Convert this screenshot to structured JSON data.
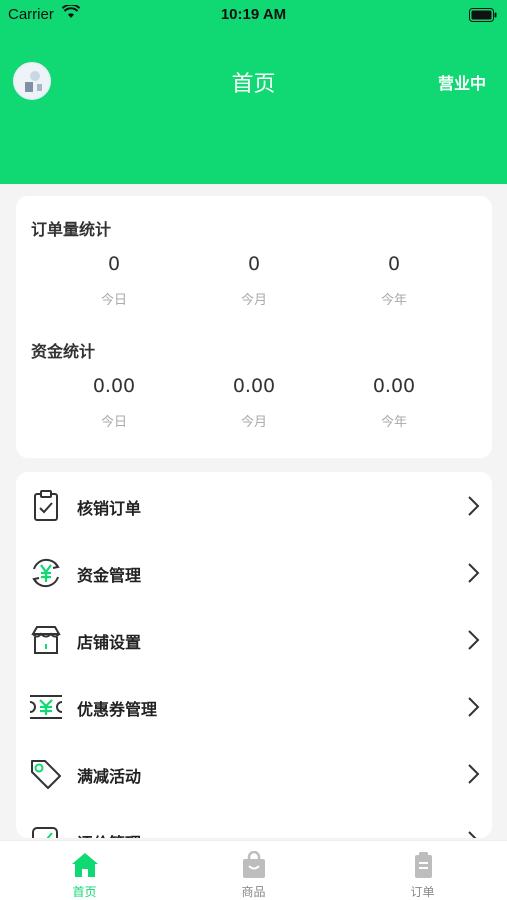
{
  "status_bar": {
    "carrier": "Carrier",
    "time": "10:19 AM"
  },
  "header": {
    "title": "首页",
    "status": "营业中"
  },
  "order_stats": {
    "title": "订单量统计",
    "items": [
      {
        "value": "0",
        "label": "今日"
      },
      {
        "value": "0",
        "label": "今月"
      },
      {
        "value": "0",
        "label": "今年"
      }
    ]
  },
  "fund_stats": {
    "title": "资金统计",
    "items": [
      {
        "value": "0.00",
        "label": "今日"
      },
      {
        "value": "0.00",
        "label": "今月"
      },
      {
        "value": "0.00",
        "label": "今年"
      }
    ]
  },
  "menu": {
    "items": [
      {
        "label": "核销订单",
        "icon": "clipboard-check-icon"
      },
      {
        "label": "资金管理",
        "icon": "yuan-cycle-icon"
      },
      {
        "label": "店铺设置",
        "icon": "shop-icon"
      },
      {
        "label": "优惠券管理",
        "icon": "coupon-icon"
      },
      {
        "label": "满减活动",
        "icon": "price-tag-icon"
      },
      {
        "label": "评价管理",
        "icon": "review-icon"
      }
    ]
  },
  "tabbar": {
    "items": [
      {
        "label": "首页",
        "icon": "home-icon",
        "active": true
      },
      {
        "label": "商品",
        "icon": "shopping-bag-icon",
        "active": false
      },
      {
        "label": "订单",
        "icon": "order-list-icon",
        "active": false
      }
    ]
  },
  "colors": {
    "accent": "#10d872",
    "background": "#f4f4f4",
    "card": "#ffffff",
    "muted": "#aaaaaa"
  }
}
